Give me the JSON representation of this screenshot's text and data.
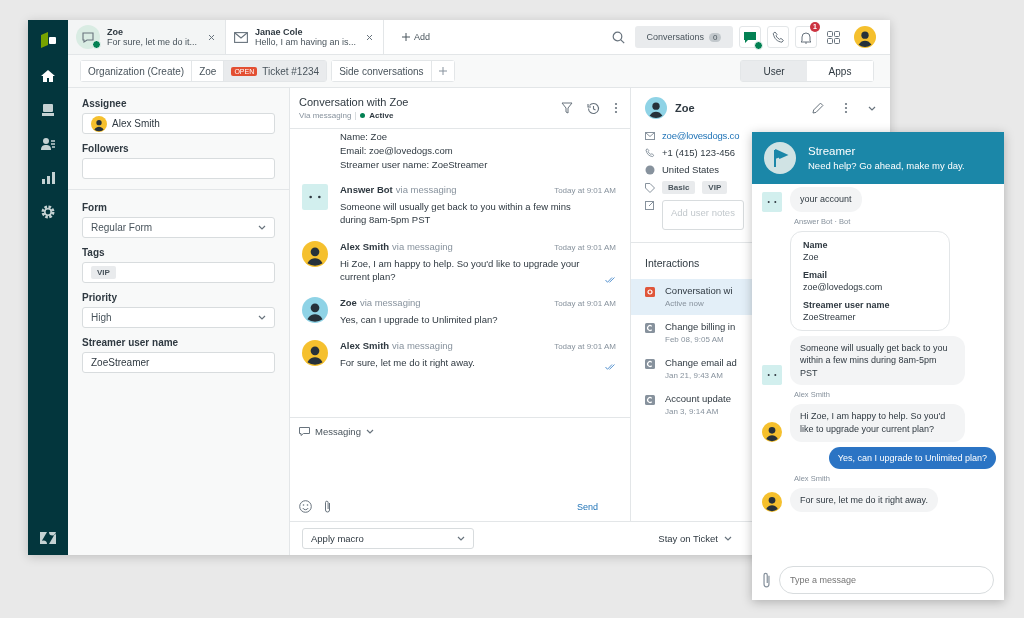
{
  "tabs": [
    {
      "kind": "chat",
      "title": "Zoe",
      "preview": "For sure, let me do it...",
      "online": true,
      "selected": true
    },
    {
      "kind": "email",
      "title": "Janae Cole",
      "preview": "Hello, I am having an is...",
      "online": false,
      "selected": false
    }
  ],
  "add_tab": "Add",
  "header": {
    "conversations_label": "Conversations",
    "conversations_count": "0",
    "chat_online": true,
    "notifications": "1"
  },
  "breadcrumbs": [
    {
      "label": "Organization (Create)",
      "selected": false
    },
    {
      "label": "Zoe",
      "selected": false
    },
    {
      "label": "Ticket #1234",
      "status": "OPEN",
      "selected": true
    }
  ],
  "side_conversations": "Side conversations",
  "context_tabs": [
    {
      "label": "User",
      "selected": true
    },
    {
      "label": "Apps",
      "selected": false
    }
  ],
  "ticket_field_groups": [
    [
      {
        "kind": "assignee",
        "label": "Assignee",
        "value": "Alex Smith"
      },
      {
        "kind": "text",
        "label": "Followers"
      }
    ],
    [
      {
        "kind": "select",
        "label": "Form",
        "value": "Regular Form"
      },
      {
        "kind": "tags",
        "label": "Tags",
        "tags": [
          "VIP"
        ]
      },
      {
        "kind": "select",
        "label": "Priority",
        "value": "High"
      },
      {
        "kind": "text",
        "label": "Streamer user name",
        "value": "ZoeStreamer"
      }
    ]
  ],
  "conversation": {
    "title": "Conversation with Zoe",
    "channel": "Via messaging",
    "status": "Active",
    "active": true,
    "intro": [
      "Name: Zoe",
      "Email: zoe@lovedogs.com",
      "Streamer user name: ZoeStreamer"
    ],
    "messages": [
      {
        "kind": "bot",
        "author": "Answer Bot",
        "via": "via messaging",
        "time": "Today at 9:01 AM",
        "text": "Someone will usually get back to you within a few mins during 8am-5pm PST",
        "read": false
      },
      {
        "kind": "agent",
        "author": "Alex Smith",
        "via": "via messaging",
        "time": "Today at 9:01 AM",
        "text": "Hi Zoe, I am happy to help. So you'd like to upgrade your current plan?",
        "read": true
      },
      {
        "kind": "customer",
        "author": "Zoe",
        "via": "via messaging",
        "time": "Today at 9:01 AM",
        "text": "Yes, can I upgrade to Unlimited plan?",
        "read": false
      },
      {
        "kind": "agent",
        "author": "Alex Smith",
        "via": "via messaging",
        "time": "Today at 9:01 AM",
        "text": "For sure, let me do it right away.",
        "read": true
      }
    ],
    "composer_channel": "Messaging",
    "send": "Send"
  },
  "user": {
    "name": "Zoe",
    "email": "zoe@lovesdogs.co",
    "phone": "+1 (415) 123-456",
    "country": "United States",
    "tags": [
      "Basic",
      "VIP"
    ],
    "notes_placeholder": "Add user notes"
  },
  "interactions": {
    "title": "Interactions",
    "items": [
      {
        "kind": "conversation",
        "title": "Conversation wi",
        "subtitle": "Active now",
        "selected": true
      },
      {
        "kind": "ticket",
        "title": "Change billing in",
        "subtitle": "Feb 08, 9:05 AM",
        "selected": false
      },
      {
        "kind": "ticket",
        "title": "Change email ad",
        "subtitle": "Jan 21, 9:43 AM",
        "selected": false
      },
      {
        "kind": "ticket",
        "title": "Account update",
        "subtitle": "Jan 3, 9:14 AM",
        "selected": false
      }
    ]
  },
  "bottom": {
    "macro": "Apply macro",
    "stay": "Stay on Ticket"
  },
  "widget": {
    "title": "Streamer",
    "subtitle": "Need help? Go ahead, make my day.",
    "messages": [
      {
        "kind": "bot",
        "text": "your account"
      },
      {
        "kind": "sender",
        "text": "Answer Bot · Bot"
      },
      {
        "kind": "card",
        "fields": [
          {
            "label": "Name",
            "value": "Zoe"
          },
          {
            "label": "Email",
            "value": "zoe@lovedogs.com"
          },
          {
            "label": "Streamer user name",
            "value": "ZoeStreamer"
          }
        ]
      },
      {
        "kind": "bot",
        "text": "Someone will usually get back to you within a few mins during 8am-5pm PST"
      },
      {
        "kind": "sender",
        "text": "Alex Smith"
      },
      {
        "kind": "agent",
        "text": "Hi Zoe, I am happy to help. So you'd like to upgrade your current plan?"
      },
      {
        "kind": "user",
        "text": "Yes, can I upgrade to Unlimited plan?"
      },
      {
        "kind": "sender",
        "text": "Alex Smith"
      },
      {
        "kind": "agent",
        "text": "For sure, let me do it right away."
      }
    ],
    "placeholder": "Type a message"
  }
}
